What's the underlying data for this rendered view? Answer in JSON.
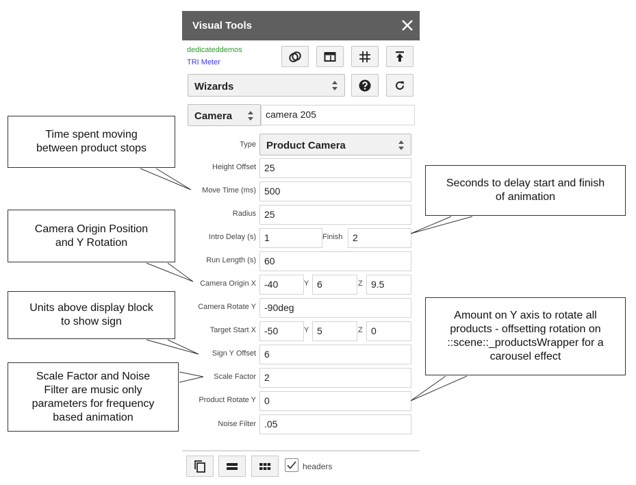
{
  "panel": {
    "title": "Visual Tools",
    "close_icon": "close-icon",
    "links": [
      "dedicateddemos",
      "TRI Meter"
    ],
    "toolbar_icons": [
      "link-icon",
      "window-icon",
      "grid-icon",
      "upload-icon"
    ],
    "wizards_select": "Wizards",
    "help_icon": "help-icon",
    "refresh_icon": "refresh-icon",
    "entity_type": "Camera",
    "entity_name": "camera 205"
  },
  "form": {
    "type_label": "Type",
    "type_value": "Product Camera",
    "height_offset_label": "Height Offset",
    "height_offset": "25",
    "move_time_label": "Move Time (ms)",
    "move_time": "500",
    "radius_label": "Radius",
    "radius": "25",
    "intro_delay_label": "Intro Delay (s)",
    "intro_delay": "1",
    "finish_label": "Finish",
    "finish": "2",
    "run_length_label": "Run Length (s)",
    "run_length": "60",
    "camera_origin_label": "Camera Origin X",
    "camera_origin_x": "-40",
    "y_label": "Y",
    "camera_origin_y": "6",
    "z_label": "Z",
    "camera_origin_z": "9.5",
    "camera_rotate_label": "Camera Rotate Y",
    "camera_rotate_y": "-90deg",
    "target_start_label": "Target Start X",
    "target_start_x": "-50",
    "target_start_y": "5",
    "target_start_z": "0",
    "sign_y_label": "Sign Y Offset",
    "sign_y": "6",
    "scale_factor_label": "Scale Factor",
    "scale_factor": "2",
    "product_rotate_label": "Product Rotate Y",
    "product_rotate_y": "0",
    "noise_filter_label": "Noise Filter",
    "noise_filter": ".05"
  },
  "bottom": {
    "icons": [
      "copy-icon",
      "single-row-icon",
      "grid-icon"
    ],
    "headers_label": "headers",
    "headers_checked": true
  },
  "callouts": {
    "move_time": [
      "Time spent moving",
      "between product stops"
    ],
    "camera_origin": [
      "Camera Origin Position",
      "and Y Rotation"
    ],
    "sign": [
      "Units above display block",
      "to show sign"
    ],
    "scale": [
      "Scale Factor and Noise",
      "Filter are music only",
      "parameters for frequency",
      "based animation"
    ],
    "delay": [
      "Seconds to delay start and finish",
      "of animation"
    ],
    "rotate": [
      "Amount on Y axis to rotate all",
      "products - offsetting rotation on",
      "::scene::_productsWrapper for a",
      "carousel effect"
    ]
  },
  "colors": {
    "header_bg": "#5f5f5f",
    "link_green": "#2e9a2e",
    "link_blue": "#3a3ad6"
  }
}
